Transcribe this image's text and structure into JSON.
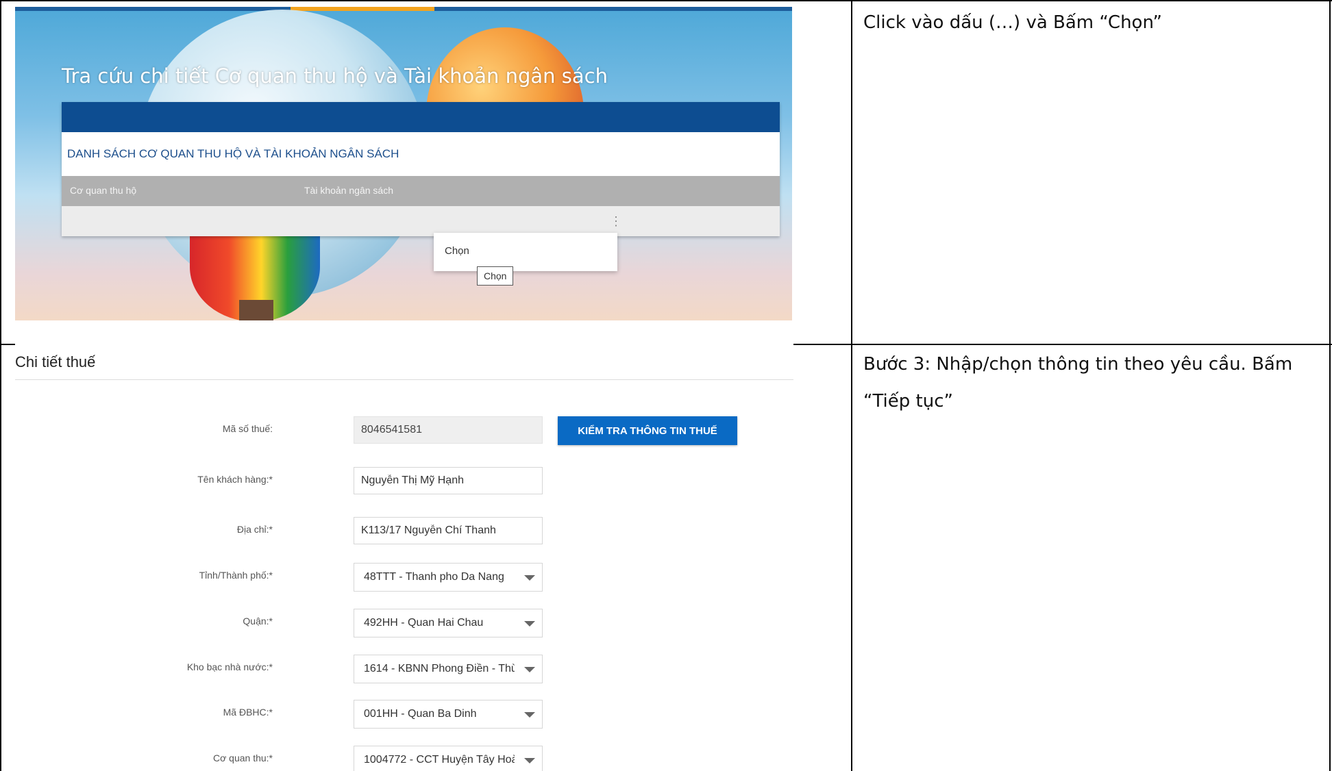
{
  "doc": {
    "row1_instruction": "Click vào dấu (…) và Bấm “Chọn”",
    "row2_instruction": "Bước 3: Nhập/chọn thông tin theo yêu cầu. Bấm “Tiếp tục”"
  },
  "lookup": {
    "hero_title": "Tra cứu chi tiết Cơ quan thu hộ và Tài khoản ngân sách",
    "list_title": "DANH SÁCH CƠ QUAN THU HỘ VÀ TÀI KHOẢN NGÂN SÁCH",
    "columns": [
      "Cơ quan thu hộ",
      "Tài khoản ngân sách"
    ],
    "row_actions_icon": "⋮",
    "menu_item": "Chọn",
    "tooltip": "Chọn"
  },
  "tax_details": {
    "section_title": "Chi tiết thuế",
    "tax_code_label": "Mã số thuế:",
    "tax_code_value": "8046541581",
    "check_button": "KIỂM TRA THÔNG TIN THUẾ",
    "customer_name_label": "Tên khách hàng:*",
    "customer_name_value": "Nguyễn Thị Mỹ Hạnh",
    "address_label": "Địa chỉ:*",
    "address_value": "K113/17 Nguyễn Chí Thanh",
    "province_label": "Tỉnh/Thành phố:*",
    "province_value": "48TTT - Thanh pho Da Nang",
    "district_label": "Quận:*",
    "district_value": "492HH - Quan Hai Chau",
    "treasury_label": "Kho bạc nhà nước:*",
    "treasury_value": "1614 - KBNN Phong Điền - Thừ",
    "admin_code_label": "Mã ĐBHC:*",
    "admin_code_value": "001HH - Quan Ba Dinh",
    "tax_office_label": "Cơ quan thu:*",
    "tax_office_value": "1004772 - CCT Huyện Tây Hoà"
  },
  "colors": {
    "panel_header": "#0d4d91",
    "button": "#0a6ac4",
    "grid_header": "#b0b0b0"
  }
}
